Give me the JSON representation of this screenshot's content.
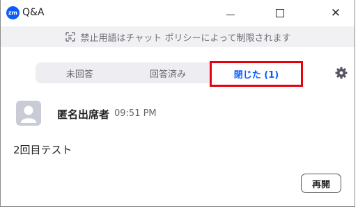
{
  "window": {
    "logo_text": "zm",
    "title": "Q&A"
  },
  "notice": {
    "text": "禁止用語はチャット ポリシーによって制限されます",
    "icon": "chat-filter-icon"
  },
  "tabs": [
    {
      "label": "未回答",
      "active": false
    },
    {
      "label": "回答済み",
      "active": false
    },
    {
      "label": "閉じた (1)",
      "active": true
    }
  ],
  "question": {
    "asker": "匿名出席者",
    "time": "09:51 PM",
    "text": "2回目テスト",
    "reopen_label": "再開"
  },
  "colors": {
    "accent": "#0b5cff",
    "highlight_border": "#e8000f",
    "tab_bg": "#eeeef2",
    "notice_bg": "#f1f1f4"
  }
}
